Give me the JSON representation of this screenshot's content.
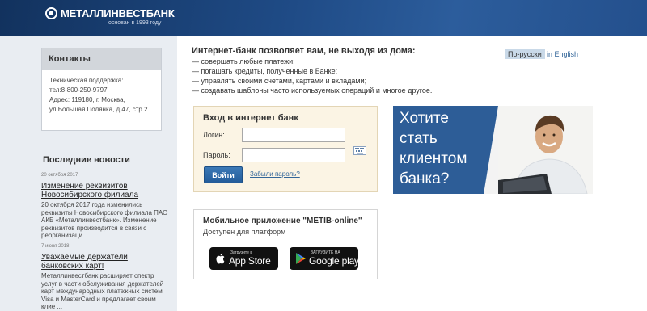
{
  "header": {
    "bank_name": "МЕТАЛЛИНВЕСТБАНК",
    "bank_tagline": "основан в 1993 году"
  },
  "sidebar": {
    "contacts": {
      "title": "Контакты",
      "lines": [
        "Техническая поддержка:",
        "тел:8-800-250-9797",
        "Адрес: 119180, г. Москва,",
        "ул.Большая Полянка, д.47, стр.2"
      ]
    },
    "news_title": "Последние новости",
    "news": [
      {
        "date": "20 октября 2017",
        "title": "Изменение реквизитов Новосибирского филиала",
        "text": "20 октября 2017 года изменились реквизиты Новосибирского филиала ПАО АКБ «Металлинвестбанк». Изменение реквизитов производится в связи с реорганизаци ..."
      },
      {
        "date": "7 июня 2018",
        "title": "Уважаемые держатели банковских карт!",
        "text": "Металлинвестбанк расширяет спектр услуг в части обслуживания держателей карт международных платежных систем Visa и MasterCard и предлагает своим клие ..."
      }
    ]
  },
  "intro": {
    "title": "Интернет-банк позволяет вам, не выходя из дома:",
    "items": [
      "— совершать любые платежи;",
      "— погашать кредиты, полученные в Банке;",
      "— управлять своими счетами, картами и вкладами;",
      "— создавать шаблоны часто используемых операций и многое другое."
    ]
  },
  "language": {
    "russian": "По-русски",
    "english": "in English"
  },
  "login": {
    "title": "Вход в интернет банк",
    "login_label": "Логин:",
    "login_value": "",
    "password_label": "Пароль:",
    "password_value": "",
    "submit": "Войти",
    "forgot": "Забыли пароль?"
  },
  "promo": {
    "lines": [
      "Хотите",
      "стать",
      "клиентом",
      "банка?"
    ]
  },
  "app": {
    "title": "Мобильное приложение \"METIB-online\"",
    "subtitle": "Доступен для платформ",
    "appstore_small": "Загрузите в",
    "appstore_big": "App Store",
    "google_small": "ЗАГРУЗИТЕ НА",
    "google_big": "Google play"
  },
  "colors": {
    "header": "#1f4b86",
    "accent_blue": "#2d5d97",
    "login_bg": "#fbf4e4",
    "link": "#336699"
  }
}
